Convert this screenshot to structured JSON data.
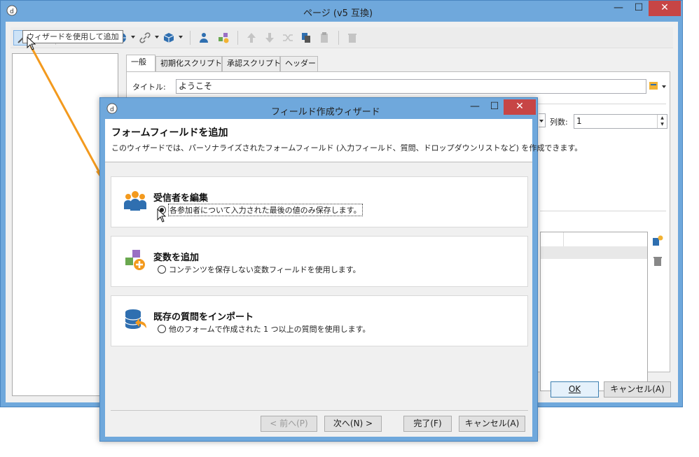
{
  "outer_window": {
    "title": "ページ (v5 互換)",
    "controls": {
      "minimize": "—",
      "maximize": "☐",
      "close": "✕"
    }
  },
  "tooltip": "ウィザードを使用して追加",
  "tabs": [
    {
      "label": "一般"
    },
    {
      "label": "初期化スクリプト"
    },
    {
      "label": "承認スクリプト"
    },
    {
      "label": "ヘッダー"
    }
  ],
  "form": {
    "title_label": "タイトル:",
    "title_value": "ようこそ",
    "columns_label": "列数:",
    "columns_value": "1"
  },
  "buttons": {
    "ok": "OK",
    "cancel": "キャンセル(A)"
  },
  "wizard": {
    "title": "フィールド作成ウィザード",
    "heading": "フォームフィールドを追加",
    "description": "このウィザードでは、パーソナライズされたフォームフィールド (入力フィールド、質問、ドロップダウンリストなど) を作成できます。",
    "options": [
      {
        "title": "受信者を編集",
        "label": "各参加者について入力された最後の値のみ保存します。",
        "selected": true,
        "icon": "people-group-icon"
      },
      {
        "title": "変数を追加",
        "label": "コンテンツを保存しない変数フィールドを使用します。",
        "selected": false,
        "icon": "add-variable-icon"
      },
      {
        "title": "既存の質問をインポート",
        "label": "他のフォームで作成された 1 つ以上の質問を使用します。",
        "selected": false,
        "icon": "database-import-icon"
      }
    ],
    "buttons": {
      "back": "< 前へ(P)",
      "next": "次へ(N) >",
      "finish": "完了(F)",
      "cancel": "キャンセル(A)"
    }
  },
  "colors": {
    "titlebar": "#6fa8dc",
    "close": "#c74545",
    "arrow": "#f39a1e"
  }
}
